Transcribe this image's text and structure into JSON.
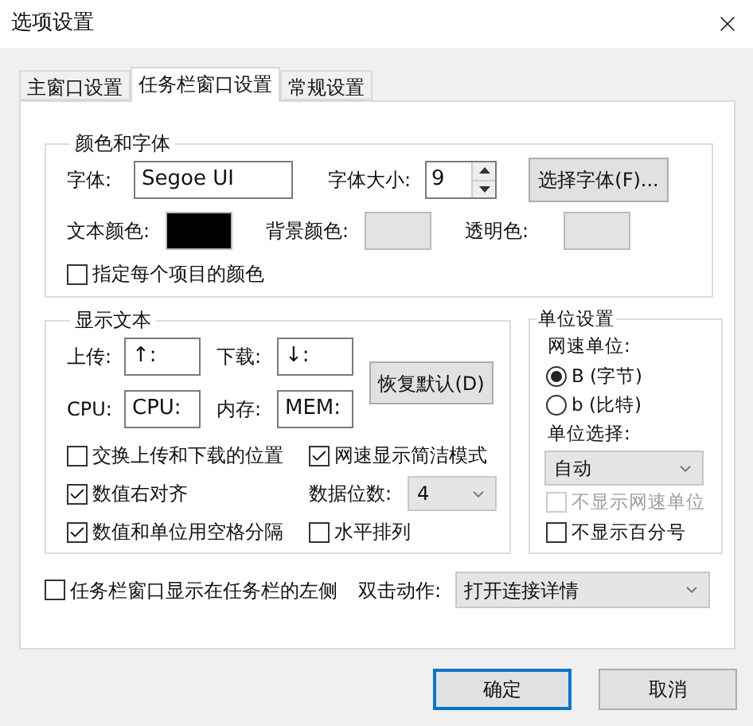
{
  "window": {
    "title": "选项设置"
  },
  "tabs": [
    {
      "label": "主窗口设置",
      "selected": false
    },
    {
      "label": "任务栏窗口设置",
      "selected": true
    },
    {
      "label": "常规设置",
      "selected": false
    }
  ],
  "color_font": {
    "title": "颜色和字体",
    "font_label": "字体:",
    "font_value": "Segoe UI",
    "size_label": "字体大小:",
    "size_value": "9",
    "choose_font_button": "选择字体(F)...",
    "swatches": [
      {
        "label": "文本颜色:",
        "color": "#000000"
      },
      {
        "label": "背景颜色:",
        "color": "#e3e3e3"
      },
      {
        "label": "透明色:",
        "color": "#e3e3e3"
      }
    ],
    "per_item_color": {
      "label": "指定每个项目的颜色",
      "checked": false
    }
  },
  "display_text": {
    "title": "显示文本",
    "fields": [
      {
        "label": "上传:",
        "value": "↑:"
      },
      {
        "label": "下载:",
        "value": "↓:"
      },
      {
        "label": "CPU:",
        "value": "CPU:"
      },
      {
        "label": "内存:",
        "value": "MEM:"
      }
    ],
    "restore_button": "恢复默认(D)",
    "swap": {
      "label": "交换上传和下载的位置",
      "checked": false
    },
    "compact": {
      "label": "网速显示简洁模式",
      "checked": true
    },
    "right_align": {
      "label": "数值右对齐",
      "checked": true
    },
    "digits": {
      "label": "数据位数:",
      "value": "4"
    },
    "space_separate": {
      "label": "数值和单位用空格分隔",
      "checked": true
    },
    "horizontal": {
      "label": "水平排列",
      "checked": false
    }
  },
  "unit": {
    "title": "单位设置",
    "speed_unit_label": "网速单位:",
    "radios": [
      {
        "label": "B (字节)",
        "selected": true
      },
      {
        "label": "b (比特)",
        "selected": false
      }
    ],
    "unit_select_label": "单位选择:",
    "unit_select_value": "自动",
    "hide_unit": {
      "label": "不显示网速单位",
      "checked": false,
      "disabled": true
    },
    "hide_percent": {
      "label": "不显示百分号",
      "checked": false,
      "disabled": false
    }
  },
  "left_side": {
    "label": "任务栏窗口显示在任务栏的左侧",
    "checked": false
  },
  "double_click": {
    "label": "双击动作:",
    "value": "打开连接详情"
  },
  "buttons": [
    {
      "label": "确定",
      "default": true
    },
    {
      "label": "取消",
      "default": false
    }
  ]
}
